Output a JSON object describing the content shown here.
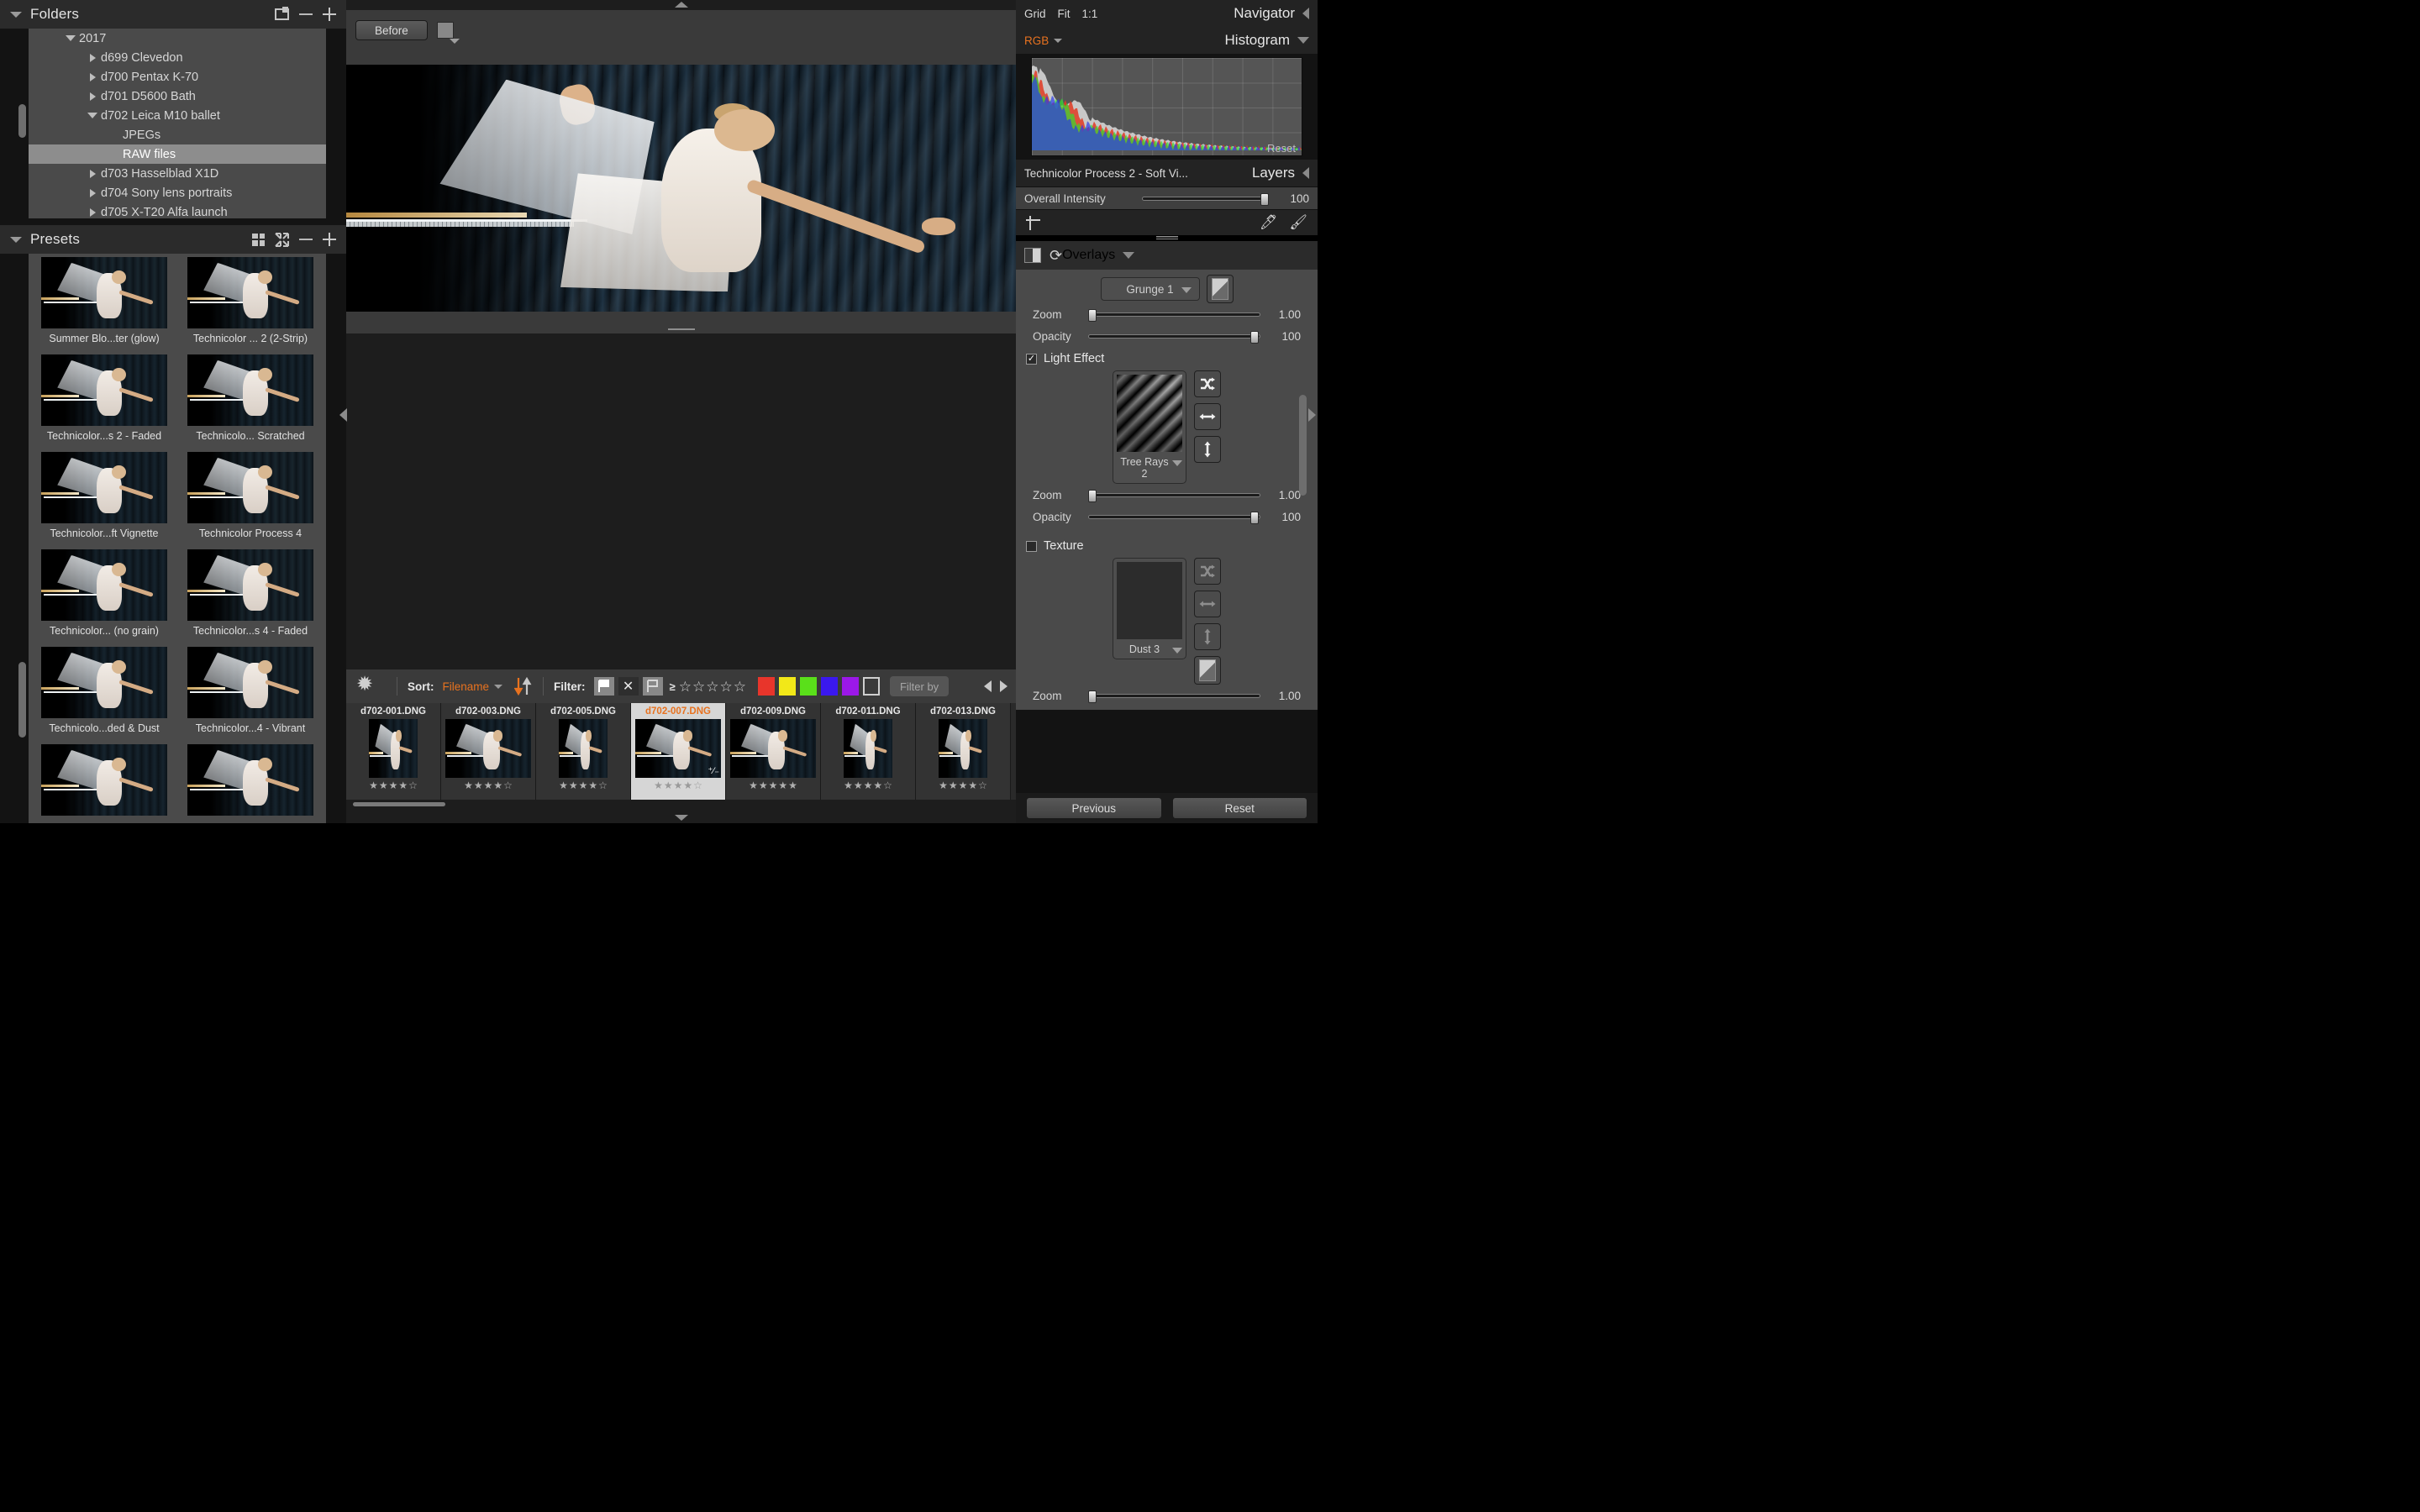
{
  "folders": {
    "title": "Folders",
    "export_icon": "export-icon",
    "minus_label": "remove-folder",
    "plus_label": "add-folder",
    "tree": [
      {
        "label": "2017",
        "depth": 0,
        "state": "expanded",
        "selected": false
      },
      {
        "label": "d699 Clevedon",
        "depth": 1,
        "state": "collapsed",
        "selected": false
      },
      {
        "label": "d700 Pentax K-70",
        "depth": 1,
        "state": "collapsed",
        "selected": false
      },
      {
        "label": "d701 D5600 Bath",
        "depth": 1,
        "state": "collapsed",
        "selected": false
      },
      {
        "label": "d702 Leica M10 ballet",
        "depth": 1,
        "state": "expanded",
        "selected": false
      },
      {
        "label": "JPEGs",
        "depth": 2,
        "state": "leaf",
        "selected": false
      },
      {
        "label": "RAW files",
        "depth": 2,
        "state": "leaf",
        "selected": true
      },
      {
        "label": "d703 Hasselblad X1D",
        "depth": 1,
        "state": "collapsed",
        "selected": false
      },
      {
        "label": "d704 Sony lens portraits",
        "depth": 1,
        "state": "collapsed",
        "selected": false
      },
      {
        "label": "d705 X-T20 Alfa launch",
        "depth": 1,
        "state": "collapsed",
        "selected": false
      }
    ]
  },
  "presets": {
    "title": "Presets",
    "grid_icon": "grid-view-icon",
    "collapse_icon": "collapse-icon",
    "items": [
      {
        "label": "Summer Blo...ter (glow)",
        "variant": "glow"
      },
      {
        "label": "Technicolor ... 2 (2-Strip)",
        "variant": "twostrip"
      },
      {
        "label": "Technicolor...s 2 - Faded",
        "variant": "faded"
      },
      {
        "label": "Technicolo... Scratched",
        "variant": "scratched"
      },
      {
        "label": "Technicolor...ft Vignette",
        "variant": "vignette"
      },
      {
        "label": "Technicolor Process 4",
        "variant": "p4"
      },
      {
        "label": "Technicolor... (no grain)",
        "variant": "nograin"
      },
      {
        "label": "Technicolor...s 4 - Faded",
        "variant": "faded4"
      },
      {
        "label": "Technicolo...ded & Dust",
        "variant": "dust"
      },
      {
        "label": "Technicolor...4 - Vibrant",
        "variant": "vibrant"
      },
      {
        "label": "",
        "variant": "row6a"
      },
      {
        "label": "",
        "variant": "row6b"
      }
    ]
  },
  "viewer": {
    "before_button": "Before",
    "swatch_name": "before-view-swatch"
  },
  "filmstrip_toolbar": {
    "gear_icon": "settings-gear-icon",
    "sort_label": "Sort:",
    "sort_value": "Filename",
    "sort_direction_icon": "sort-direction-icon",
    "filter_label": "Filter:",
    "flag_picked_icon": "flag-picked-icon",
    "flag_rejected_icon": "flag-rejected-icon",
    "flag_unflagged_icon": "flag-unflagged-icon",
    "rating_operator": "≥",
    "rating_stars": 0,
    "rating_max": 5,
    "color_labels": [
      "#e8352b",
      "#f2e818",
      "#5ae01a",
      "#3a18ef",
      "#9b18e8"
    ],
    "color_none": "none",
    "filter_by_placeholder": "Filter by",
    "prev_icon": "previous-image-icon",
    "next_icon": "next-image-icon"
  },
  "filmstrip": {
    "items": [
      {
        "filename": "d702-001.DNG",
        "stars": 4,
        "selected": false,
        "wide": false
      },
      {
        "filename": "d702-003.DNG",
        "stars": 4,
        "selected": false,
        "wide": true
      },
      {
        "filename": "d702-005.DNG",
        "stars": 4,
        "selected": false,
        "wide": false
      },
      {
        "filename": "d702-007.DNG",
        "stars": 4,
        "selected": true,
        "wide": true
      },
      {
        "filename": "d702-009.DNG",
        "stars": 5,
        "selected": false,
        "wide": true
      },
      {
        "filename": "d702-011.DNG",
        "stars": 4,
        "selected": false,
        "wide": false
      },
      {
        "filename": "d702-013.DNG",
        "stars": 4,
        "selected": false,
        "wide": false
      }
    ]
  },
  "navigator": {
    "title": "Navigator",
    "modes": [
      "Grid",
      "Fit",
      "1:1"
    ],
    "collapse_icon": "collapse-left-icon"
  },
  "histogram": {
    "title": "Histogram",
    "channel": "RGB",
    "reset_label": "Reset",
    "accent": "#e8721f"
  },
  "layers": {
    "title": "Layers",
    "active_layer": "Technicolor Process 2 - Soft Vi...",
    "intensity_label": "Overall Intensity",
    "intensity_value": "100",
    "intensity_pct": 97,
    "crop_icon": "crop-icon",
    "eraser_icon": "eraser-icon",
    "brush_icon": "brush-icon"
  },
  "overlays": {
    "title": "Overlays",
    "split_icon": "split-view-icon",
    "refresh_icon": "refresh-icon",
    "grunge": {
      "name": "Grunge  1",
      "invert_icon": "invert-icon",
      "zoom_label": "Zoom",
      "zoom_value": "1.00",
      "zoom_pct": 2,
      "opacity_label": "Opacity",
      "opacity_value": "100",
      "opacity_pct": 97
    },
    "light_effect": {
      "label": "Light Effect",
      "checked": true,
      "name": "Tree Rays 2",
      "shuffle_icon": "shuffle-icon",
      "flip_h_icon": "flip-horizontal-icon",
      "flip_v_icon": "flip-vertical-icon",
      "zoom_label": "Zoom",
      "zoom_value": "1.00",
      "zoom_pct": 2,
      "opacity_label": "Opacity",
      "opacity_value": "100",
      "opacity_pct": 97
    },
    "texture": {
      "label": "Texture",
      "checked": false,
      "name": "Dust  3",
      "shuffle_icon": "shuffle-icon",
      "flip_h_icon": "flip-horizontal-icon",
      "flip_v_icon": "flip-vertical-icon",
      "invert_icon": "invert-icon",
      "zoom_label": "Zoom",
      "zoom_value": "1.00",
      "zoom_pct": 2
    }
  },
  "bottom_buttons": {
    "previous": "Previous",
    "reset": "Reset"
  }
}
